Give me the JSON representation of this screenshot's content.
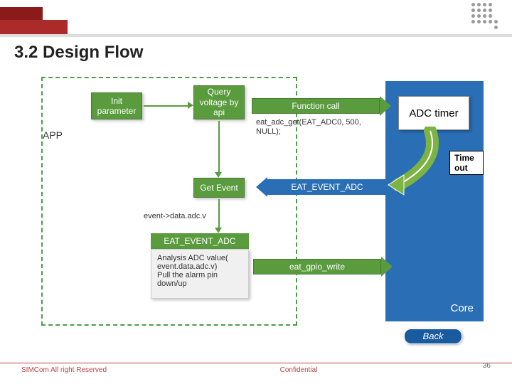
{
  "title": "3.2 Design Flow",
  "app_label": "APP",
  "boxes": {
    "init_param": "Init parameter",
    "query_voltage": "Query voltage by api",
    "get_event": "Get Event",
    "event_title": "EAT_EVENT_ADC",
    "event_body": "Analysis ADC value( event.data.adc.v)\nPull the alarm pin down/up",
    "adc_timer": "ADC timer",
    "core": "Core",
    "timeout": "Time out"
  },
  "arrows": {
    "function_call": "Function call",
    "eat_event_adc": "EAT_EVENT_ADC",
    "eat_gpio_write": "eat_gpio_write"
  },
  "annotations": {
    "api_call": "eat_adc_get(EAT_ADC0, 500, NULL);",
    "event_data": "event->data.adc.v"
  },
  "back_button": "Back",
  "footer": {
    "left": "SIMCom All right Reserved",
    "center": "Confidential"
  },
  "page_number": "36"
}
